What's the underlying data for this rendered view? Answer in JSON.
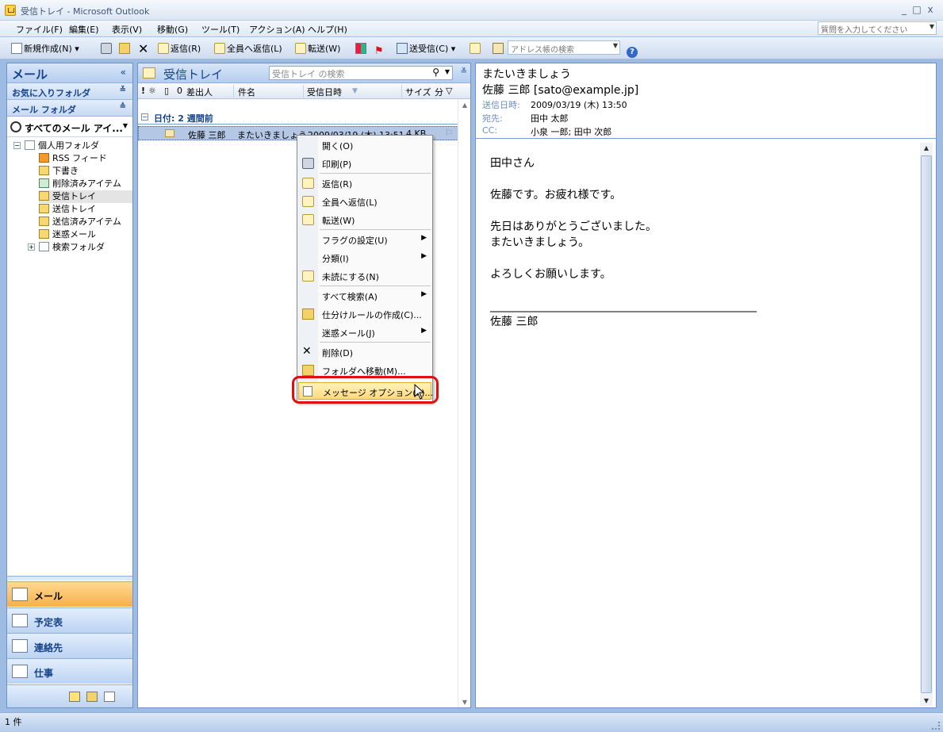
{
  "window": {
    "title": "受信トレイ - Microsoft Outlook",
    "minimize": "_",
    "restore": "□",
    "close": "x"
  },
  "menu": {
    "items": [
      "ファイル(F)",
      "編集(E)",
      "表示(V)",
      "移動(G)",
      "ツール(T)",
      "アクション(A)",
      "ヘルプ(H)"
    ],
    "help_placeholder": "質問を入力してください"
  },
  "toolbar": {
    "new": "新規作成(N)",
    "reply": "返信(R)",
    "reply_all": "全員へ返信(L)",
    "forward": "転送(W)",
    "send_receive": "送受信(C)",
    "address_search_placeholder": "アドレス帳の検索"
  },
  "nav": {
    "title": "メール",
    "favorites": "お気に入りフォルダ",
    "mail_folders": "メール フォルダ",
    "all_items": "すべてのメール アイ...",
    "tree": [
      {
        "label": "個人用フォルダ"
      },
      {
        "label": "RSS フィード"
      },
      {
        "label": "下書き"
      },
      {
        "label": "削除済みアイテム"
      },
      {
        "label": "受信トレイ"
      },
      {
        "label": "送信トレイ"
      },
      {
        "label": "送信済みアイテム"
      },
      {
        "label": "迷惑メール"
      },
      {
        "label": "検索フォルダ"
      }
    ],
    "buttons": [
      "メール",
      "予定表",
      "連絡先",
      "仕事"
    ]
  },
  "list": {
    "title": "受信トレイ",
    "search_placeholder": "受信トレイ の検索",
    "columns": {
      "from": "差出人",
      "subject": "件名",
      "received": "受信日時",
      "size": "サイズ"
    },
    "group": "日付: 2 週間前",
    "message": {
      "from": "佐藤 三郎",
      "subject": "またいきましょう",
      "received": "2009/03/19 (木) 13:51",
      "size": "4 KB"
    }
  },
  "context_menu": {
    "items": [
      "開く(O)",
      "印刷(P)",
      "返信(R)",
      "全員へ返信(L)",
      "転送(W)",
      "フラグの設定(U)",
      "分類(I)",
      "未読にする(N)",
      "すべて検索(A)",
      "仕分けルールの作成(C)...",
      "迷惑メール(J)",
      "削除(D)",
      "フォルダへ移動(M)...",
      "メッセージ オプション(P)..."
    ]
  },
  "reading": {
    "subject": "またいきましょう",
    "from": "佐藤 三郎 [sato@example.jp]",
    "sent_label": "送信日時:",
    "sent": "2009/03/19 (木) 13:50",
    "to_label": "宛先:",
    "to": "田中 太郎",
    "cc_label": "CC:",
    "cc": "小泉 一郎; 田中 次郎",
    "body": "田中さん\n\n佐藤です。お疲れ様です。\n\n先日はありがとうございました。\nまたいきましょう。\n\nよろしくお願いします。\n\n________________________________________________\n佐藤 三郎"
  },
  "status": {
    "count": "1 件"
  }
}
